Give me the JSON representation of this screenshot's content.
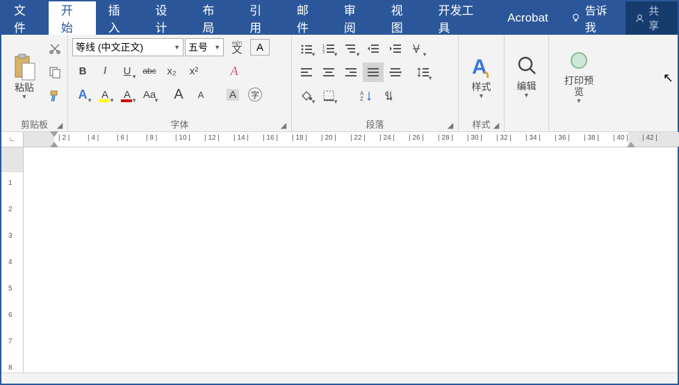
{
  "tabs": {
    "file": "文件",
    "home": "开始",
    "insert": "插入",
    "design": "设计",
    "layout": "布局",
    "references": "引用",
    "mailings": "邮件",
    "review": "审阅",
    "view": "视图",
    "developer": "开发工具",
    "acrobat": "Acrobat",
    "tellme": "告诉我",
    "share": "共享"
  },
  "clipboard": {
    "paste": "粘贴",
    "group": "剪贴板"
  },
  "font": {
    "name": "等线 (中文正文)",
    "size": "五号",
    "wen_top": "wén",
    "wen": "文",
    "char_a": "A",
    "bold": "B",
    "italic": "I",
    "underline": "U",
    "strike": "abc",
    "sub": "x₂",
    "sup": "x²",
    "bigA": "A",
    "smallA": "A",
    "Aa": "Aa",
    "clear": "A",
    "highlight": "A",
    "fontcolor": "A",
    "circled": "A",
    "charframe": "字",
    "group": "字体"
  },
  "paragraph": {
    "group": "段落"
  },
  "styles": {
    "label": "样式",
    "group": "样式"
  },
  "editing": {
    "label": "编辑"
  },
  "printpreview": {
    "label": "打印预览"
  },
  "ruler": {
    "h": [
      "2",
      "4",
      "6",
      "8",
      "10",
      "12",
      "14",
      "16",
      "18",
      "20",
      "22",
      "24",
      "26",
      "28",
      "30",
      "32",
      "34",
      "36",
      "38",
      "40",
      "42"
    ],
    "v": [
      "1",
      "2",
      "3",
      "4",
      "5",
      "6",
      "7",
      "8"
    ]
  }
}
